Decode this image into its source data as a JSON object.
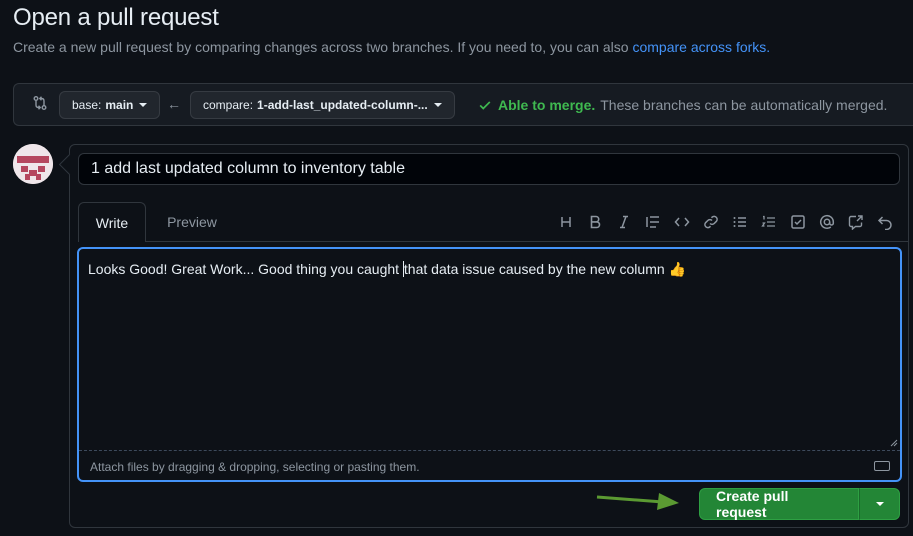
{
  "header": {
    "title": "Open a pull request",
    "subtitle_text": "Create a new pull request by comparing changes across two branches. If you need to, you can also",
    "subtitle_link": "compare across forks."
  },
  "range": {
    "base_key": "base:",
    "base_value": "main",
    "compare_key": "compare:",
    "compare_value": "1-add-last_updated-column-...",
    "merge_ok": "Able to merge.",
    "merge_desc": "These branches can be automatically merged."
  },
  "composer": {
    "title_value": "1 add last updated column to inventory table",
    "tabs": {
      "write": "Write",
      "preview": "Preview"
    },
    "toolbar_icons": [
      "heading-icon",
      "bold-icon",
      "italic-icon",
      "quote-icon",
      "code-icon",
      "link-icon",
      "unordered-list-icon",
      "ordered-list-icon",
      "task-list-icon",
      "mention-icon",
      "cross-reference-icon",
      "undo-icon"
    ],
    "body_before_cursor": "Looks Good! Great Work... Good thing you caught ",
    "body_after_cursor": "that data issue caused by the new column 👍",
    "attach_hint": "Attach files by dragging & dropping, selecting or pasting them."
  },
  "actions": {
    "create_label": "Create pull request"
  },
  "colors": {
    "accent_blue": "#4493f8",
    "success_green": "#3fb950",
    "button_green": "#238636",
    "annotation_arrow": "#5b9a32"
  }
}
